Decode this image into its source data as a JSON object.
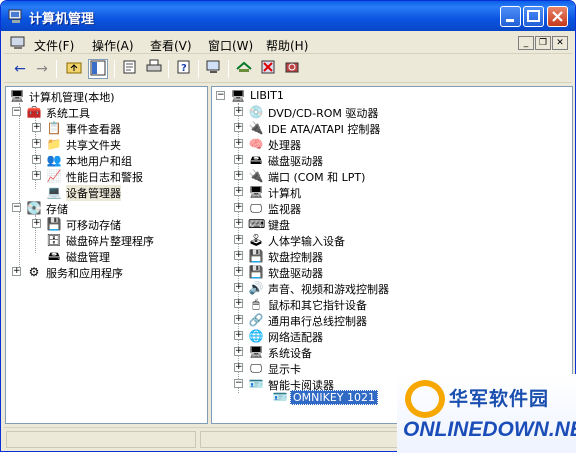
{
  "window": {
    "title": "计算机管理"
  },
  "menu": [
    "文件(F)",
    "操作(A)",
    "查看(V)",
    "窗口(W)",
    "帮助(H)"
  ],
  "mdi": {
    "minimize": "_",
    "restore": "❐",
    "close": "✕"
  },
  "left_tree": {
    "root": "计算机管理(本地)",
    "system_tools": "系统工具",
    "system_tools_children": [
      "事件查看器",
      "共享文件夹",
      "本地用户和组",
      "性能日志和警报",
      "设备管理器"
    ],
    "storage": "存储",
    "storage_children": [
      "可移动存储",
      "磁盘碎片整理程序",
      "磁盘管理"
    ],
    "services": "服务和应用程序"
  },
  "right_tree": {
    "root": "LIBIT1",
    "devices": [
      "DVD/CD-ROM 驱动器",
      "IDE ATA/ATAPI 控制器",
      "处理器",
      "磁盘驱动器",
      "端口 (COM 和 LPT)",
      "计算机",
      "监视器",
      "键盘",
      "人体学输入设备",
      "软盘控制器",
      "软盘驱动器",
      "声音、视频和游戏控制器",
      "鼠标和其它指针设备",
      "通用串行总线控制器",
      "网络适配器",
      "系统设备",
      "显示卡",
      "智能卡阅读器"
    ],
    "smartcard_child": "OMNIKEY 1021"
  },
  "watermark": {
    "cn": "华军软件园",
    "en": "ONLINEDOWN.NET"
  }
}
